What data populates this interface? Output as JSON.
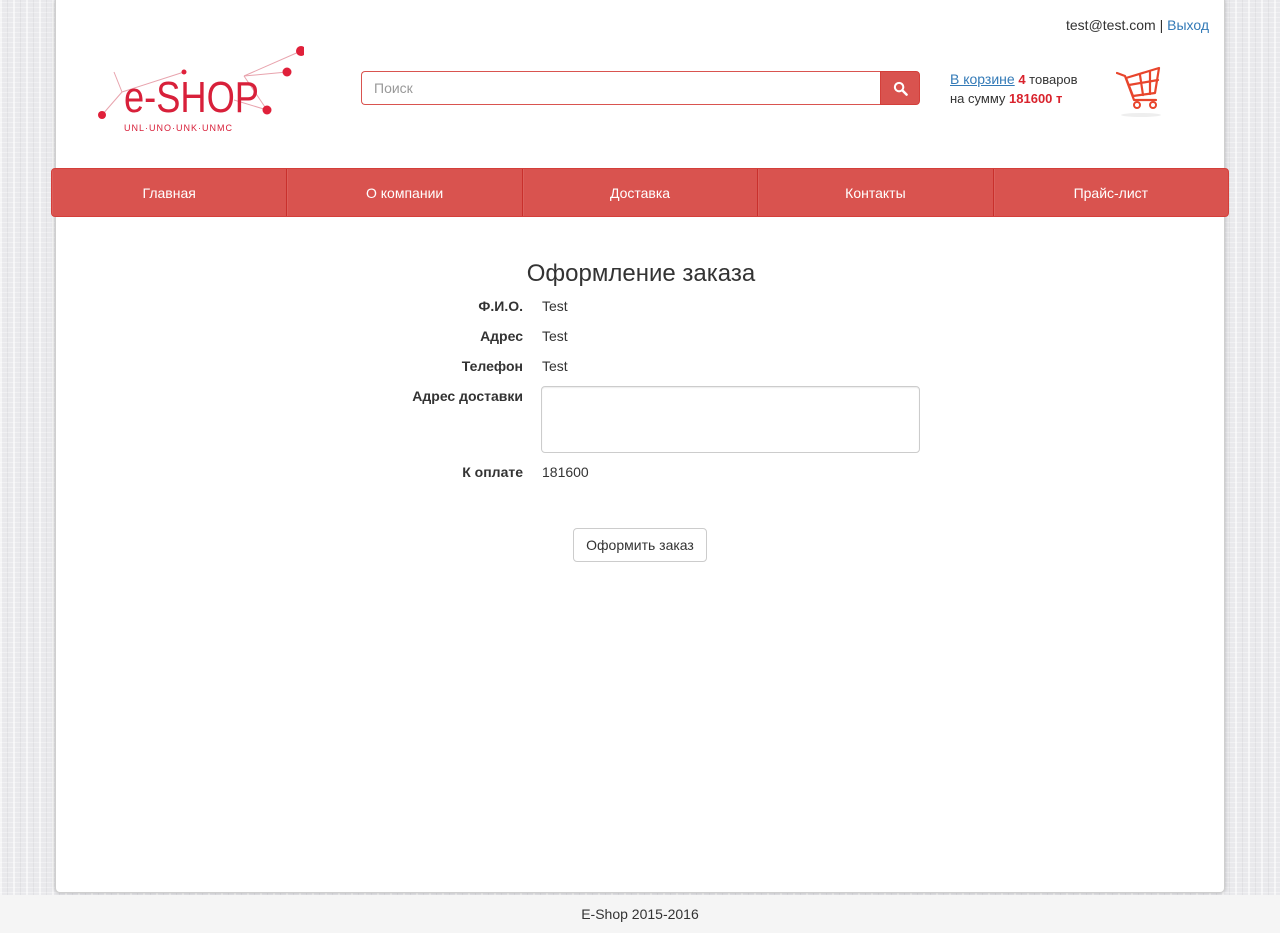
{
  "header": {
    "user_email": "test@test.com",
    "separator": "|",
    "logout_label": "Выход",
    "logo_text": "e-SHOP",
    "logo_tagline": "UNL·UNO·UNK·UNMC",
    "search": {
      "placeholder": "Поиск",
      "value": ""
    },
    "cart": {
      "link_label": "В корзине",
      "count": "4",
      "items_word": "товаров",
      "sum_label": "на сумму",
      "sum_value": "181600 т"
    }
  },
  "nav": {
    "items": [
      {
        "label": "Главная"
      },
      {
        "label": "О компании"
      },
      {
        "label": "Доставка"
      },
      {
        "label": "Контакты"
      },
      {
        "label": "Прайс-лист"
      }
    ]
  },
  "order": {
    "title": "Оформление заказа",
    "fields": [
      {
        "label": "Ф.И.О.",
        "value": "Test"
      },
      {
        "label": "Адрес",
        "value": "Test"
      },
      {
        "label": "Телефон",
        "value": "Test"
      },
      {
        "label": "Адрес доставки",
        "value": ""
      },
      {
        "label": "К оплате",
        "value": "181600"
      }
    ],
    "submit_label": "Оформить заказ"
  },
  "footer": {
    "text": "E-Shop 2015-2016"
  },
  "colors": {
    "accent": "#d9534f",
    "link": "#337ab7",
    "highlight": "#d9232d"
  },
  "icons": {
    "search": "search-icon",
    "cart": "shopping-cart-icon",
    "logo": "eshop-logo"
  }
}
